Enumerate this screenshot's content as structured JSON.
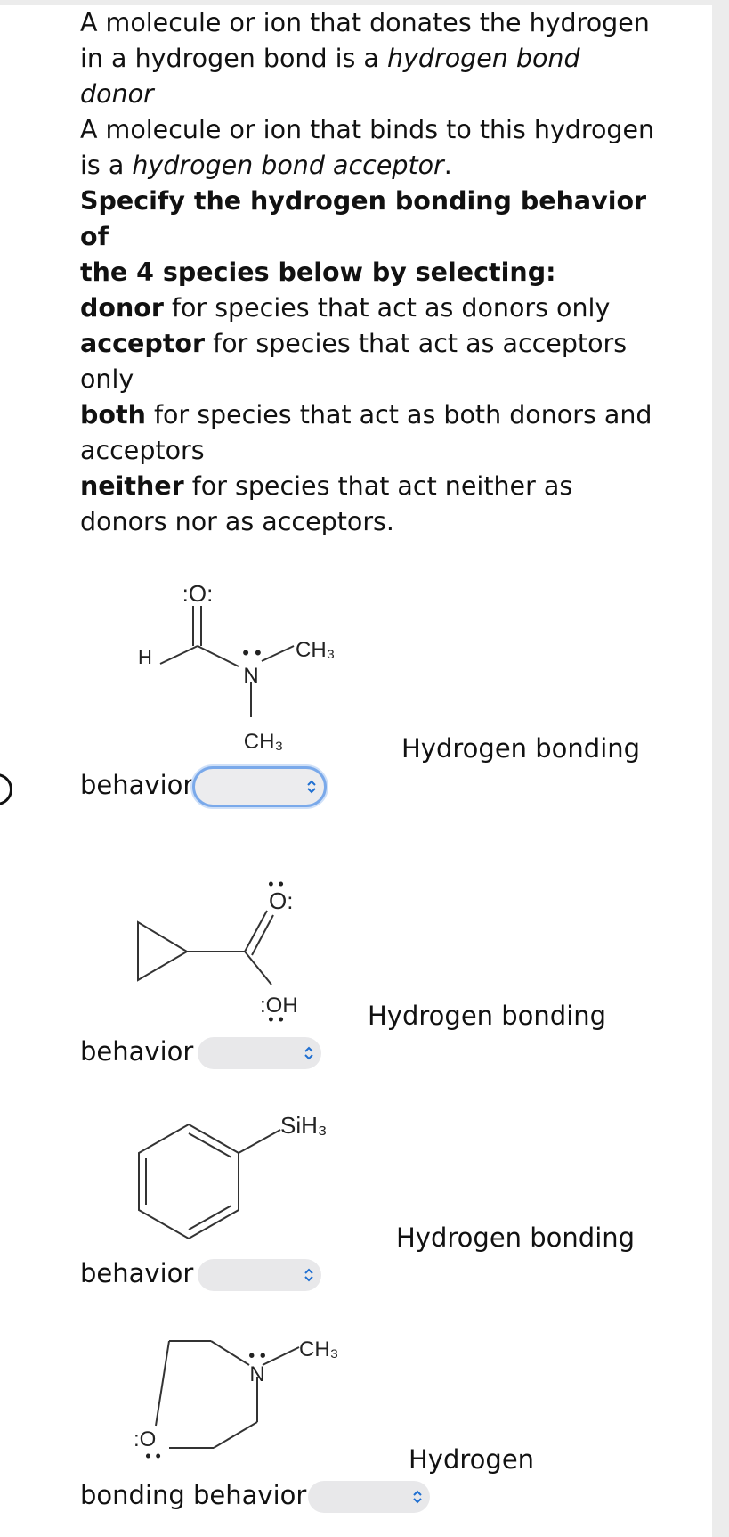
{
  "instructions": {
    "l1": "A molecule or ion that donates the hydrogen",
    "l2a": "in a hydrogen bond is a ",
    "l2b": "hydrogen bond",
    "l3": "donor",
    "l4": "A molecule or ion that binds to this hydrogen",
    "l5a": "is a ",
    "l5b": "hydrogen bond acceptor",
    "l5c": ".",
    "l6": "Specify the hydrogen bonding behavior of",
    "l7": "the 4 species below by selecting:",
    "donor_term": "donor",
    "donor_desc": " for species that act as donors only",
    "acceptor_term": "acceptor",
    "acceptor_desc": " for species that act as acceptors",
    "acceptor_desc2": "only",
    "both_term": "both",
    "both_desc": " for species that act as both donors and",
    "both_desc2": "acceptors",
    "neither_term": "neither",
    "neither_desc": " for species that act neither as",
    "neither_desc2": "donors nor as acceptors."
  },
  "molecules": {
    "m1": {
      "o": ":O:",
      "h": "H",
      "n": "N",
      "ch3_top": "CH3",
      "ch3_bottom": "CH3"
    },
    "m2": {
      "o": "O:",
      "oh": ":OH"
    },
    "m3": {
      "sih3": "SiH3"
    },
    "m4": {
      "n": "N",
      "ch3": "CH3",
      "o": ":O"
    }
  },
  "questions": [
    {
      "prompt_right": "Hydrogen bonding",
      "prompt_left": "behavior",
      "selected": ""
    },
    {
      "prompt_right": "Hydrogen bonding",
      "prompt_left": "behavior",
      "selected": ""
    },
    {
      "prompt_right": "Hydrogen bonding",
      "prompt_left": "behavior",
      "selected": ""
    },
    {
      "prompt_right": "Hydrogen",
      "prompt_left": "bonding behavior",
      "selected": ""
    }
  ],
  "icons": {
    "select_chevron": "up-down-chevron-icon"
  },
  "colors": {
    "focus_ring": "#7aa9ea",
    "select_bg": "#e8e8ea",
    "chevron": "#1f6fd1"
  }
}
